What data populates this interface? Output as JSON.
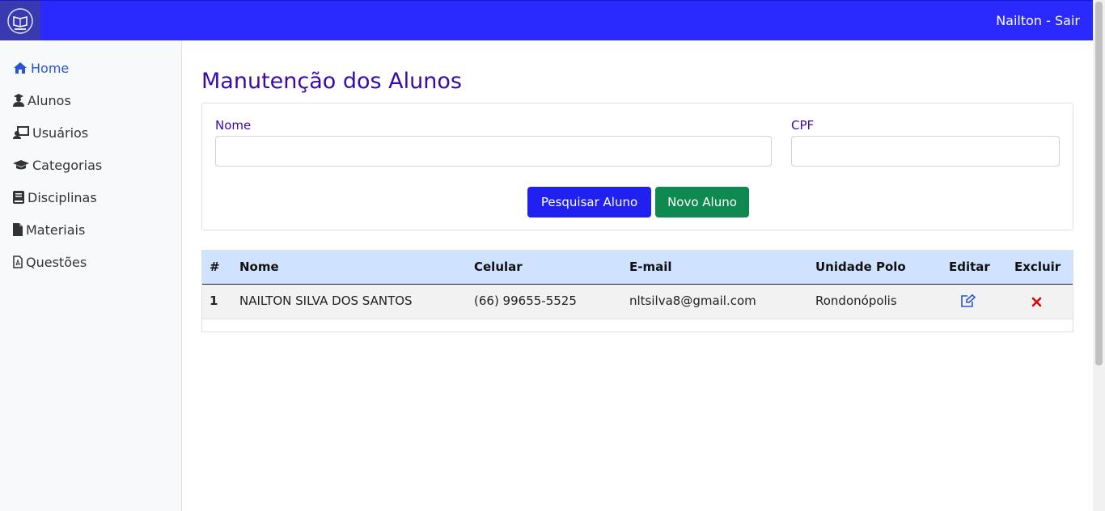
{
  "header": {
    "user_link": "Nailton - Sair",
    "logo_icon": "graduation-book-logo",
    "bg_color": "#2a2aff"
  },
  "sidebar": {
    "items": [
      {
        "label": "Home",
        "icon": "home-icon",
        "active": true
      },
      {
        "label": "Alunos",
        "icon": "student-icon"
      },
      {
        "label": "Usuários",
        "icon": "users-icon"
      },
      {
        "label": "Categorias",
        "icon": "graduation-cap-icon"
      },
      {
        "label": "Disciplinas",
        "icon": "book-icon"
      },
      {
        "label": "Materiais",
        "icon": "file-icon"
      },
      {
        "label": "Questões",
        "icon": "pdf-file-icon"
      }
    ]
  },
  "main": {
    "title": "Manutenção dos Alunos",
    "form": {
      "nome_label": "Nome",
      "nome_value": "",
      "cpf_label": "CPF",
      "cpf_value": "",
      "search_button": "Pesquisar Aluno",
      "new_button": "Novo Aluno"
    },
    "table": {
      "headers": [
        "#",
        "Nome",
        "Celular",
        "E-mail",
        "Unidade Polo",
        "Editar",
        "Excluir"
      ],
      "rows": [
        {
          "num": "1",
          "nome": "NAILTON SILVA DOS SANTOS",
          "celular": "(66) 99655-5525",
          "email": "nltsilva8@gmail.com",
          "polo": "Rondonópolis"
        }
      ]
    }
  },
  "colors": {
    "accent": "#2a2aff",
    "title": "#3a0aa8",
    "search_button": "#2020f0",
    "new_button": "#0e8a50",
    "table_header": "#cfe2ff",
    "delete": "#e00000"
  }
}
